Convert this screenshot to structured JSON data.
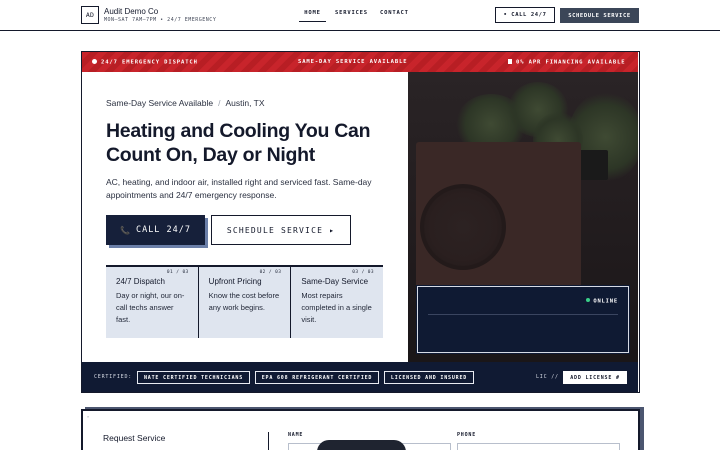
{
  "header": {
    "logo_text": "AD",
    "brand_name": "Audit Demo Co",
    "hours": "MON–SAT 7AM–7PM • 24/7 EMERGENCY",
    "nav": [
      "HOME",
      "SERVICES",
      "CONTACT"
    ],
    "call_label": "• CALL 24/7",
    "schedule_label": "SCHEDULE SERVICE"
  },
  "alert_bar": {
    "left": "24/7 EMERGENCY DISPATCH",
    "center": "SAME-DAY SERVICE AVAILABLE",
    "right": "0% APR FINANCING AVAILABLE"
  },
  "hero": {
    "availability": "Same-Day Service Available",
    "separator": "/",
    "location": "Austin, TX",
    "headline": "Heating and Cooling You Can Count On, Day or Night",
    "subtext": "AC, heating, and indoor air, installed right and serviced fast. Same-day appointments and 24/7 emergency response.",
    "call_button": "CALL 24/7",
    "phone_icon_glyph": "📞",
    "schedule_button": "SCHEDULE SERVICE ▸"
  },
  "features": [
    {
      "num": "01 / 03",
      "title": "24/7 Dispatch",
      "desc": "Day or night, our on-call techs answer fast."
    },
    {
      "num": "02 / 03",
      "title": "Upfront Pricing",
      "desc": "Know the cost before any work begins."
    },
    {
      "num": "03 / 03",
      "title": "Same-Day Service",
      "desc": "Most repairs completed in a single visit."
    }
  ],
  "status_panel": {
    "status": "ONLINE",
    "status_color": "#3ad089"
  },
  "cert_bar": {
    "label": "CERTIFIED:",
    "badges": [
      "NATE CERTIFIED TECHNICIANS",
      "EPA 608 REFRIGERANT CERTIFIED",
      "LICENSED AND INSURED"
    ],
    "lic_label": "LIC //",
    "add_license": "ADD LICENSE #"
  },
  "form": {
    "corner_mark": "»",
    "title": "Request Service",
    "name_label": "NAME",
    "phone_label": "PHONE"
  },
  "colors": {
    "navy": "#101a33",
    "red": "#c8242b",
    "slate_button": "#3b4658",
    "feature_bg": "#dfe5ef"
  }
}
